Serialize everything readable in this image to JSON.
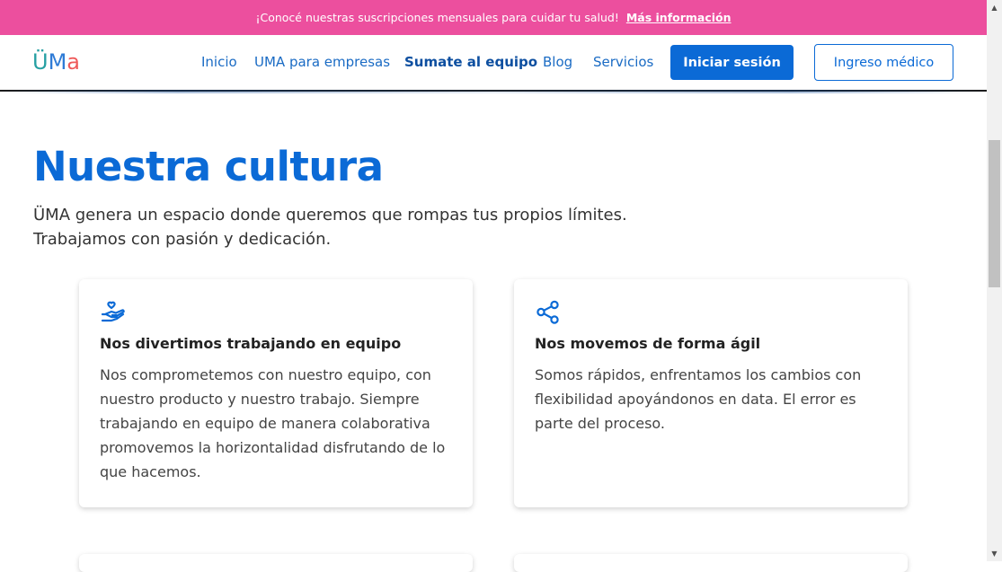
{
  "promo": {
    "text": "¡Conocé nuestras suscripciones mensuales para cuidar tu salud!",
    "link_label": "Más información"
  },
  "logo": {
    "part1": "Ü",
    "part2": "M",
    "part3": "a"
  },
  "nav": {
    "links": [
      {
        "label": "Inicio"
      },
      {
        "label": "UMA para empresas"
      },
      {
        "label": "Sumate al equipo"
      },
      {
        "label": "Blog"
      },
      {
        "label": "Servicios"
      }
    ],
    "login_label": "Iniciar sesión",
    "doctor_label": "Ingreso médico"
  },
  "hero": {
    "title": "Nuestra cultura",
    "line1": "ÜMA genera un espacio donde queremos que rompas tus propios límites.",
    "line2": "Trabajamos con pasión y dedicación."
  },
  "cards": [
    {
      "icon": "hand-heart-icon",
      "title": "Nos divertimos trabajando en equipo",
      "text": "Nos comprometemos con nuestro equipo, con nuestro producto y nuestro trabajo. Siempre trabajando en equipo de manera colaborativa promovemos la horizontalidad disfrutando de lo que hacemos."
    },
    {
      "icon": "share-icon",
      "title": "Nos movemos de forma ágil",
      "text": "Somos rápidos, enfrentamos los cambios con flexibilidad apoyándonos en data. El error es parte del proceso."
    }
  ],
  "colors": {
    "promo_bg": "#ec4f9e",
    "brand_blue": "#0b6ad6"
  }
}
